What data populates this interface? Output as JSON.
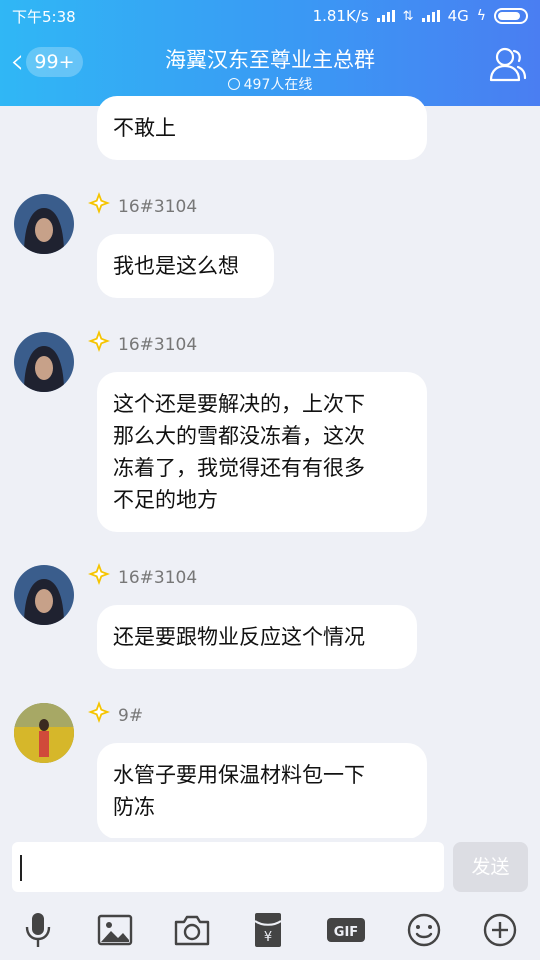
{
  "status_bar": {
    "time": "下午5:38",
    "speed": "1.81K/s",
    "network": "4G"
  },
  "header": {
    "unread_badge": "99+",
    "title": "海翼汉东至尊业主总群",
    "online_count": "497人在线"
  },
  "messages": [
    {
      "nick": "",
      "lines": [
        "不敢上"
      ]
    },
    {
      "nick": "16#3104",
      "lines": [
        "我也是这么想"
      ]
    },
    {
      "nick": "16#3104",
      "lines": [
        "这个还是要解决的，上次下",
        "那么大的雪都没冻着，这次",
        "冻着了，我觉得还有有很多",
        "不足的地方"
      ]
    },
    {
      "nick": "16#3104",
      "lines": [
        "还是要跟物业反应这个情况"
      ]
    },
    {
      "nick": "9#",
      "lines": [
        "水管子要用保温材料包一下",
        "防冻"
      ]
    }
  ],
  "input": {
    "value": "",
    "send_label": "发送"
  },
  "toolbar": {
    "items": [
      "mic-icon",
      "image-icon",
      "camera-icon",
      "red-packet-icon",
      "gif-icon",
      "emoji-icon",
      "plus-icon"
    ],
    "gif_label": "GIF"
  },
  "colors": {
    "header_gradient_start": "#30b7f5",
    "header_gradient_end": "#4a7ef2",
    "background": "#eef0f6",
    "bubble": "#ffffff",
    "star": "#f5c400"
  }
}
